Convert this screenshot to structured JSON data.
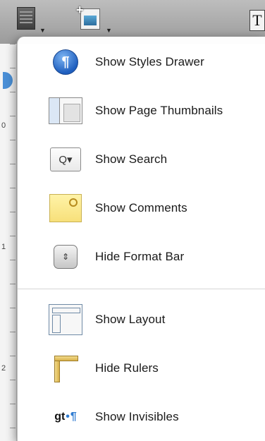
{
  "toolbar": {
    "buttons": [
      {
        "name": "view-menu-button",
        "icon": "view-doc-icon"
      },
      {
        "name": "insert-button",
        "icon": "insert-media-icon"
      },
      {
        "name": "text-box-button",
        "icon": "text-box-icon",
        "label": "T"
      }
    ]
  },
  "ruler": {
    "numbers": [
      "0",
      "1",
      "2"
    ]
  },
  "menu": {
    "items": [
      {
        "label": "Show Styles Drawer",
        "icon": "styles-drawer-icon"
      },
      {
        "label": "Show Page Thumbnails",
        "icon": "page-thumbnails-icon"
      },
      {
        "label": "Show Search",
        "icon": "search-icon"
      },
      {
        "label": "Show Comments",
        "icon": "comments-icon"
      },
      {
        "label": "Hide Format Bar",
        "icon": "format-bar-icon"
      },
      {
        "label": "Show Layout",
        "icon": "layout-icon"
      },
      {
        "label": "Hide Rulers",
        "icon": "rulers-icon"
      },
      {
        "label": "Show Invisibles",
        "icon": "invisibles-icon"
      }
    ]
  },
  "glyphs": {
    "styles": "¶",
    "search": "Q▾",
    "format": "⇕",
    "invisibles_text": "gt",
    "invisibles_dot": "•",
    "invisibles_pilcrow": "¶"
  },
  "colors": {
    "accent": "#2f7bd1",
    "menu_bg": "#ffffff"
  }
}
